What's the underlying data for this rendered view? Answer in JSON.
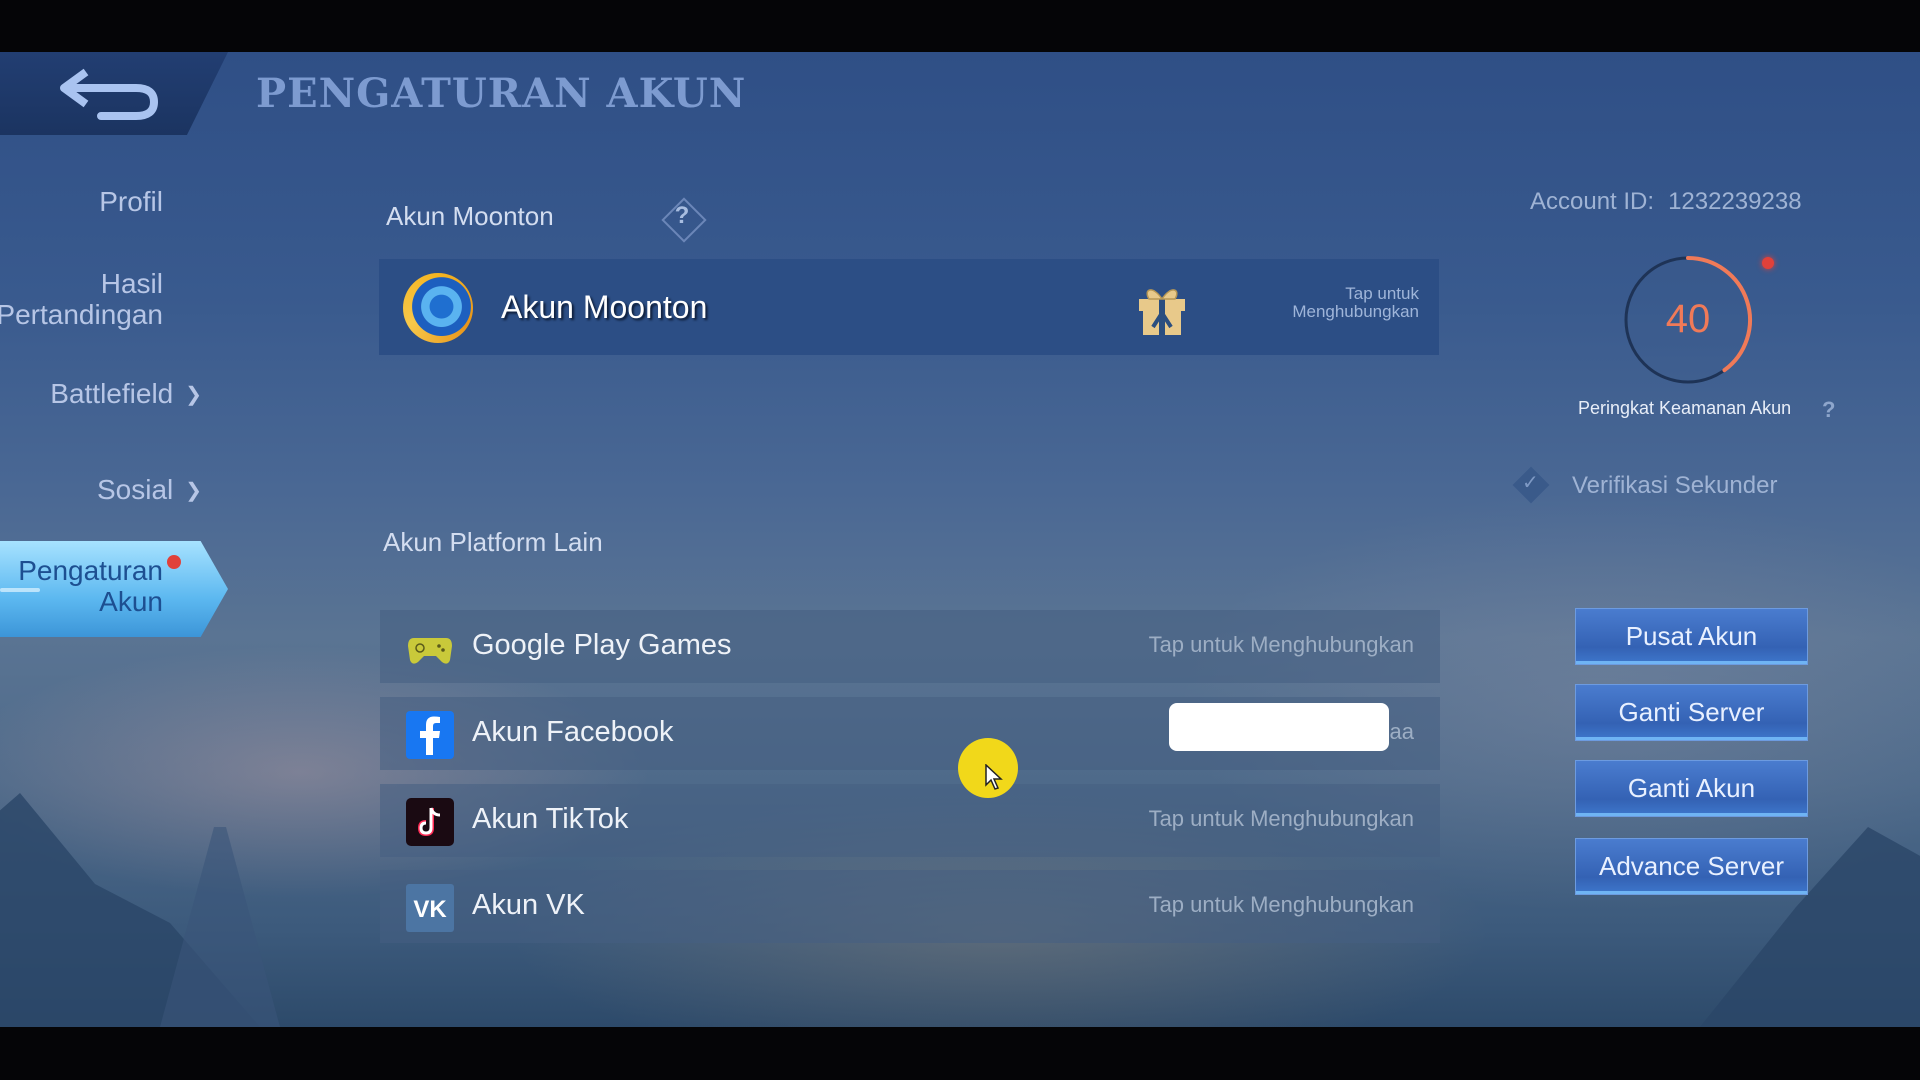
{
  "header": {
    "title": "PENGATURAN AKUN",
    "back_icon": "back-arrow-icon"
  },
  "sidebar": {
    "items": [
      {
        "label": "Profil"
      },
      {
        "label": "Hasil Pertandingan"
      },
      {
        "label": "Battlefield",
        "icon": "chevron-down-icon"
      },
      {
        "label": "Sosial",
        "icon": "chevron-down-icon"
      },
      {
        "label": "Pengaturan Akun",
        "active": true,
        "has_notification": true
      }
    ],
    "chevron": "⌄"
  },
  "main": {
    "moonton_section": {
      "label": "Akun Moonton",
      "help": "?",
      "card": {
        "name": "Akun Moonton",
        "icon": "moonton-logo-icon",
        "reward_icon": "gift-icon",
        "action": "Tap untuk Menghubungkan"
      }
    },
    "other_section": {
      "label": "Akun Platform Lain",
      "platforms": [
        {
          "name": "Google Play Games",
          "icon": "gamepad-icon",
          "action": "Tap untuk Menghubungkan"
        },
        {
          "name": "Akun Facebook",
          "icon": "facebook-icon",
          "action": "aa",
          "redacted": true
        },
        {
          "name": "Akun TikTok",
          "icon": "tiktok-icon",
          "action": "Tap untuk Menghubungkan"
        },
        {
          "name": "Akun VK",
          "icon": "vk-icon",
          "action": "Tap untuk Menghubungkan"
        }
      ]
    }
  },
  "right_panel": {
    "account_id_label": "Account ID:",
    "account_id": "1232239238",
    "security_score": "40",
    "security_fraction": 0.4,
    "security_label": "Peringkat Keamanan Akun",
    "security_help": "?",
    "verification_label": "Verifikasi Sekunder",
    "buttons": [
      "Pusat Akun",
      "Ganti Server",
      "Ganti Akun",
      "Advance Server"
    ]
  },
  "colors": {
    "accent_gauge": "#f07a58",
    "notification": "#e0413a",
    "button_blue": "#3462b4",
    "active_tab": "#5cb8f0",
    "cursor_highlight": "#f1d81a"
  }
}
